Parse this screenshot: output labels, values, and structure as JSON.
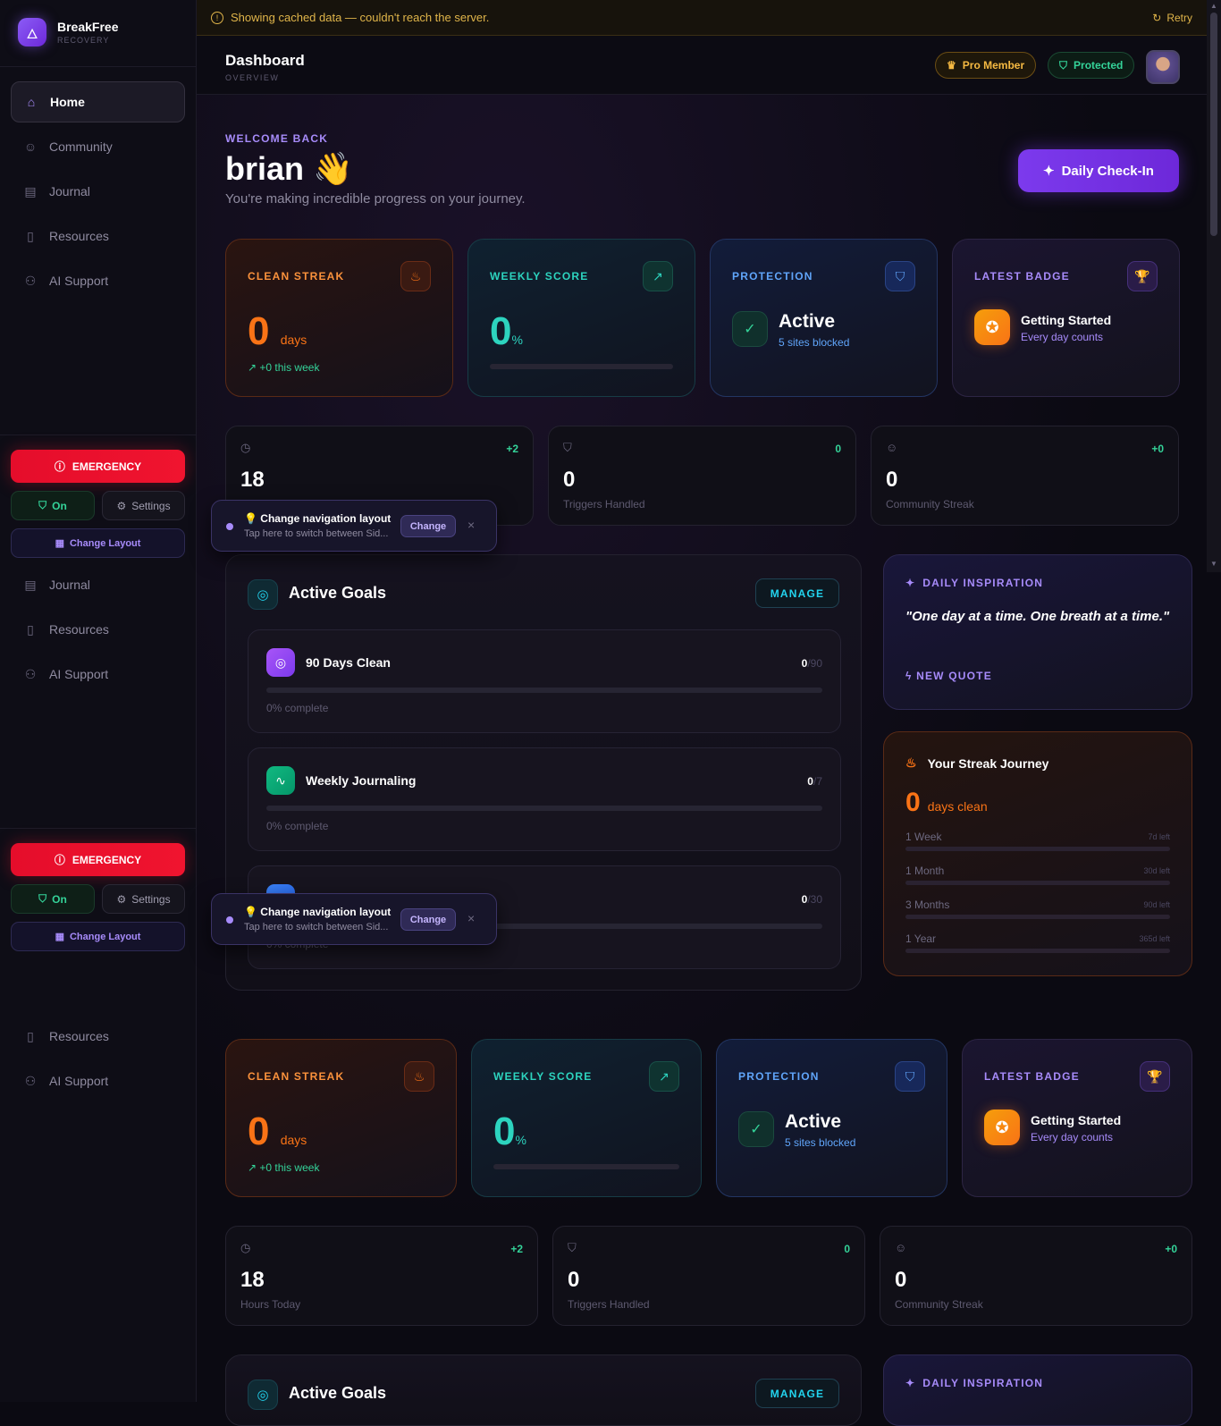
{
  "app": {
    "name": "BreakFree",
    "sub": "RECOVERY"
  },
  "nav": {
    "home": "Home",
    "community": "Community",
    "journal": "Journal",
    "resources": "Resources",
    "ai": "AI Support"
  },
  "sidebar_controls": {
    "emergency": "EMERGENCY",
    "on": "On",
    "settings": "Settings",
    "change_layout": "Change Layout"
  },
  "banner": {
    "message": "Showing cached data — couldn't reach the server.",
    "retry": "Retry"
  },
  "header": {
    "title": "Dashboard",
    "subtitle": "OVERVIEW",
    "pro": "Pro Member",
    "protected": "Protected"
  },
  "welcome": {
    "kicker": "WELCOME BACK",
    "name": "brian",
    "wave": "👋",
    "tagline": "You're making incredible progress on your journey.",
    "checkin": "Daily Check-In"
  },
  "cards": {
    "streak": {
      "label": "CLEAN STREAK",
      "value": "0",
      "unit": "days",
      "week": "+0 this week"
    },
    "score": {
      "label": "WEEKLY SCORE",
      "value": "0",
      "unit": "%",
      "progress": 0
    },
    "protection": {
      "label": "PROTECTION",
      "status": "Active",
      "detail": "5 sites blocked"
    },
    "badge": {
      "label": "LATEST BADGE",
      "name": "Getting Started",
      "desc": "Every day counts"
    }
  },
  "stats": [
    {
      "value": "18",
      "label": "Hours Today",
      "delta": "+2"
    },
    {
      "value": "0",
      "label": "Triggers Handled",
      "delta": "0"
    },
    {
      "value": "0",
      "label": "Community Streak",
      "delta": "+0"
    }
  ],
  "toast": {
    "title": "Change navigation layout",
    "desc": "Tap here to switch between Sid...",
    "button": "Change",
    "close": "×"
  },
  "goals": {
    "title": "Active Goals",
    "manage": "MANAGE",
    "items": [
      {
        "name": "90 Days Clean",
        "current": "0",
        "target": "/90",
        "progress_text": "0% complete",
        "progress": 0
      },
      {
        "name": "Weekly Journaling",
        "current": "0",
        "target": "/7",
        "progress_text": "0% complete",
        "progress": 0
      },
      {
        "name": "",
        "current": "0",
        "target": "/30",
        "progress_text": "0% complete",
        "progress": 0
      }
    ]
  },
  "inspiration": {
    "label": "DAILY INSPIRATION",
    "quote": "\"One day at a time. One breath at a time.\"",
    "new": "NEW QUOTE"
  },
  "journey": {
    "title": "Your Streak Journey",
    "value": "0",
    "unit": "days clean",
    "milestones": [
      {
        "name": "1 Week",
        "left": "7d left"
      },
      {
        "name": "1 Month",
        "left": "30d left"
      },
      {
        "name": "3 Months",
        "left": "90d left"
      },
      {
        "name": "1 Year",
        "left": "365d left"
      }
    ]
  },
  "colors": {
    "accent": "#7c3aed",
    "emergency": "#f0142f",
    "success": "#34d399",
    "streak": "#f97316",
    "score": "#22d3ee"
  }
}
